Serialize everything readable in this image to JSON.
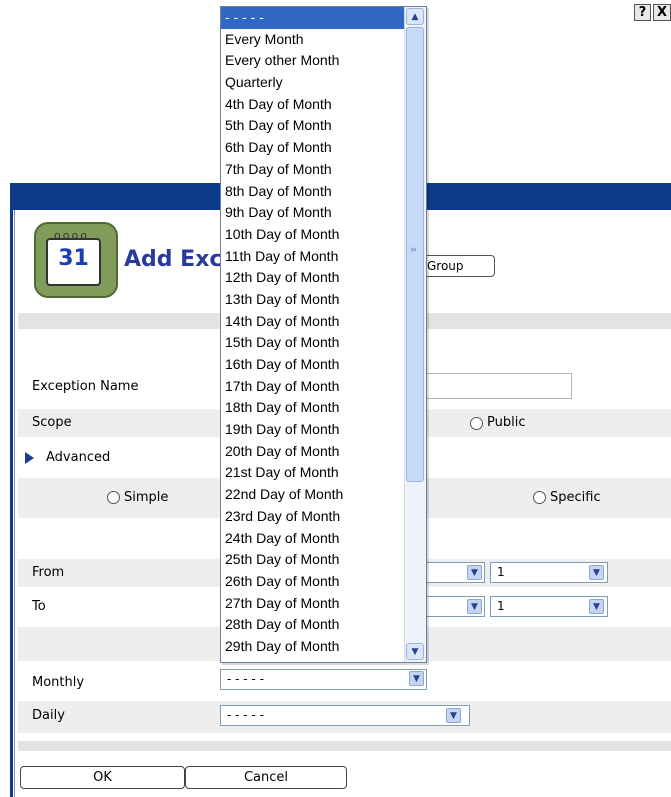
{
  "titlebar": {
    "help_label": "?",
    "close_label": "X"
  },
  "dialog": {
    "title": "Add Exc",
    "icon_day": "31",
    "group_button": "Group"
  },
  "form": {
    "exception_name_label": "Exception Name",
    "exception_name_value": "",
    "scope_label": "Scope",
    "public_label": "Public",
    "advanced_label": "Advanced",
    "simple_label": "Simple",
    "specific_label": "Specific",
    "from_label": "From",
    "from_value": "1",
    "to_label": "To",
    "to_value": "1",
    "monthly_label": "Monthly",
    "monthly_value": "- - - - -",
    "daily_label": "Daily",
    "daily_value": "- - - - -"
  },
  "dropdown": {
    "items": [
      "- - - - -",
      "Every Month",
      "Every other Month",
      "Quarterly",
      "4th Day of Month",
      "5th Day of Month",
      "6th Day of Month",
      "7th Day of Month",
      "8th Day of Month",
      "9th Day of Month",
      "10th Day of Month",
      "11th Day of Month",
      "12th Day of Month",
      "13th Day of Month",
      "14th Day of Month",
      "15th Day of Month",
      "16th Day of Month",
      "17th Day of Month",
      "18th Day of Month",
      "19th Day of Month",
      "20th Day of Month",
      "21st Day of Month",
      "22nd Day of Month",
      "23rd Day of Month",
      "24th Day of Month",
      "25th Day of Month",
      "26th Day of Month",
      "27th Day of Month",
      "28th Day of Month",
      "29th Day of Month"
    ],
    "selected_index": 0
  },
  "buttons": {
    "ok": "OK",
    "cancel": "Cancel"
  },
  "colors": {
    "titlebar": "#0e3a8c",
    "selection": "#3168c6",
    "title_text": "#2a3a9a"
  }
}
